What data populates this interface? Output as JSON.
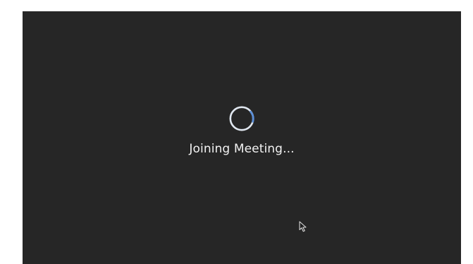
{
  "meeting": {
    "status_text": "Joining Meeting...",
    "spinner_icon": "loading-spinner-icon",
    "cursor_icon": "mouse-pointer-icon"
  },
  "colors": {
    "window_background": "#262626",
    "page_background": "#ffffff",
    "text": "#f2f2f2",
    "spinner_ring": "#dfe6ef",
    "spinner_accent": "#5b8fd8"
  }
}
